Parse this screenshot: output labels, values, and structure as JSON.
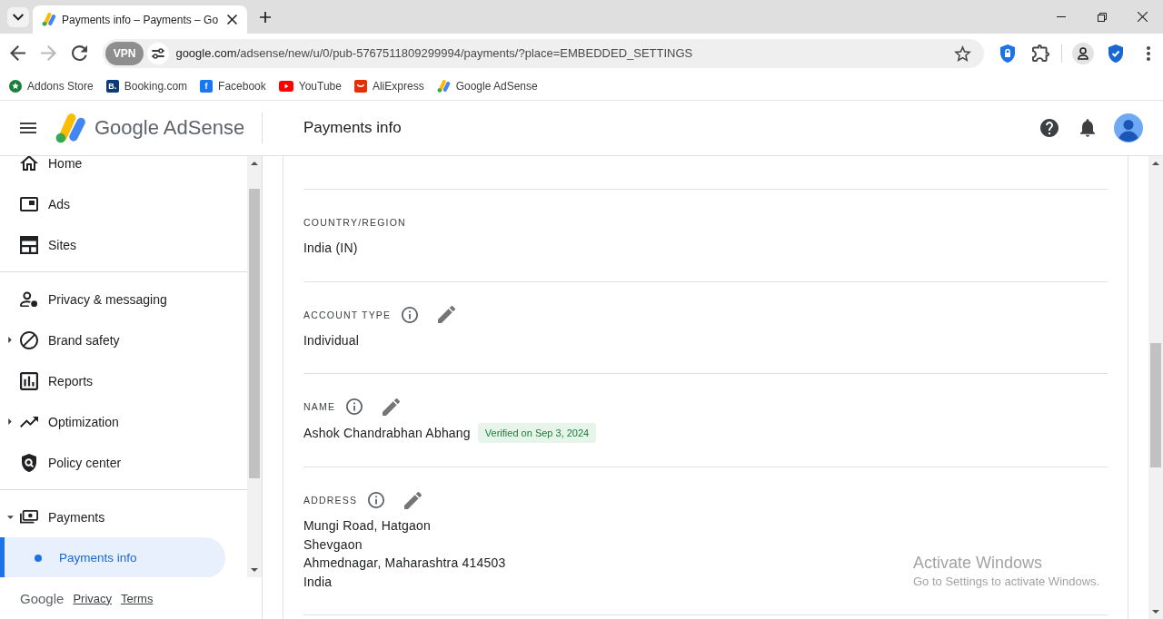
{
  "browser": {
    "tabs": [
      {
        "title": "Payments info – Payments – Go",
        "selected": true
      }
    ],
    "nav_buttons": [
      {
        "kind": "back",
        "disabled": false
      },
      {
        "kind": "forward",
        "disabled": true
      },
      {
        "kind": "reload",
        "disabled": false
      }
    ],
    "address_bar": {
      "vpn_label": "VPN",
      "host": "google.com",
      "path": "/adsense/new/u/0/pub-5767511809299994/payments/?place=EMBEDDED_SETTINGS"
    },
    "bookmarks": [
      {
        "label": "Addons Store",
        "kind": "star"
      },
      {
        "label": "Booking.com",
        "kind": "letter",
        "icon_text": "B.",
        "color": "#0c3b7c"
      },
      {
        "label": "Facebook",
        "kind": "letter",
        "icon_text": "f",
        "color": "#1877f2"
      },
      {
        "label": "YouTube",
        "kind": "play"
      },
      {
        "label": "AliExpress",
        "kind": "smile"
      },
      {
        "label": "Google AdSense",
        "kind": "logo"
      }
    ]
  },
  "app_header": {
    "product_name": "Google AdSense",
    "page_title": "Payments info"
  },
  "sidebar": {
    "groups": [
      {
        "items": [
          {
            "label": "Home",
            "kind": "link",
            "selected": false
          },
          {
            "label": "Ads",
            "kind": "link",
            "selected": false
          },
          {
            "label": "Sites",
            "kind": "link",
            "selected": false
          }
        ]
      },
      {
        "items": [
          {
            "label": "Privacy & messaging",
            "kind": "link",
            "selected": false
          },
          {
            "label": "Brand safety",
            "kind": "expandable",
            "expanded": false,
            "selected": false
          },
          {
            "label": "Reports",
            "kind": "link",
            "selected": false
          },
          {
            "label": "Optimization",
            "kind": "expandable",
            "expanded": false,
            "selected": false
          },
          {
            "label": "Policy center",
            "kind": "link",
            "selected": false
          }
        ]
      },
      {
        "items": [
          {
            "label": "Payments",
            "kind": "expandable",
            "expanded": true,
            "selected": false,
            "children": [
              {
                "label": "Payments info",
                "selected": true
              }
            ]
          }
        ]
      }
    ],
    "footer": {
      "brand": "Google",
      "links": [
        "Privacy",
        "Terms"
      ]
    }
  },
  "content": {
    "sections": [
      {
        "label": "COUNTRY/REGION",
        "info": false,
        "editable": false,
        "lines": [
          "India (IN)"
        ]
      },
      {
        "label": "ACCOUNT TYPE",
        "info": true,
        "editable": true,
        "lines": [
          "Individual"
        ]
      },
      {
        "label": "NAME",
        "info": true,
        "editable": true,
        "lines": [
          "Ashok Chandrabhan Abhang"
        ],
        "badge": "Verified on Sep 3, 2024"
      },
      {
        "label": "ADDRESS",
        "info": true,
        "editable": true,
        "lines": [
          "Mungi Road, Hatgaon",
          "Shevgaon",
          "Ahmednagar, Maharashtra 414503",
          "India"
        ]
      }
    ]
  },
  "os_notice": {
    "title": "Activate Windows",
    "subtitle": "Go to Settings to activate Windows."
  }
}
